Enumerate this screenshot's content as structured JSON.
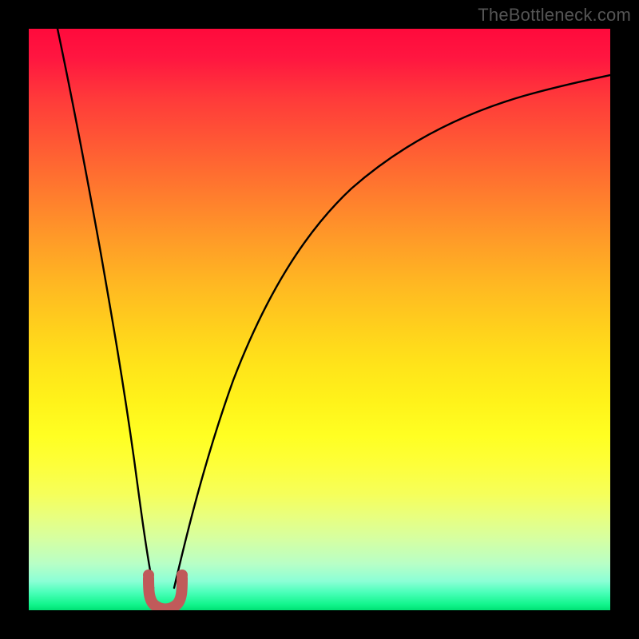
{
  "watermark": {
    "text": "TheBottleneck.com"
  },
  "colors": {
    "curve": "#000000",
    "minimum_marker": "#c05a5a",
    "minimum_marker_inner": "#b84e4e"
  },
  "chart_data": {
    "type": "line",
    "title": "",
    "xlabel": "",
    "ylabel": "",
    "xlim": [
      0,
      100
    ],
    "ylim": [
      0,
      100
    ],
    "grid": false,
    "legend": false,
    "annotations": [
      {
        "type": "minimum_marker",
        "x": 21.5,
        "shape": "U",
        "color": "#c05a5a"
      }
    ],
    "series": [
      {
        "name": "left-branch",
        "x": [
          5.0,
          6.5,
          8.0,
          9.5,
          11.0,
          12.5,
          14.0,
          15.5,
          17.0,
          18.5,
          20.0
        ],
        "y": [
          100.0,
          89.0,
          78.0,
          67.0,
          56.0,
          45.0,
          36.0,
          27.5,
          19.0,
          11.0,
          4.0
        ]
      },
      {
        "name": "right-branch",
        "x": [
          23.0,
          26.0,
          30.0,
          35.0,
          40.0,
          46.0,
          53.0,
          60.0,
          68.0,
          77.0,
          86.0,
          95.0,
          100.0
        ],
        "y": [
          4.0,
          14.0,
          26.0,
          37.0,
          46.0,
          54.0,
          61.0,
          66.5,
          71.5,
          76.0,
          79.8,
          83.0,
          84.5
        ]
      }
    ]
  }
}
